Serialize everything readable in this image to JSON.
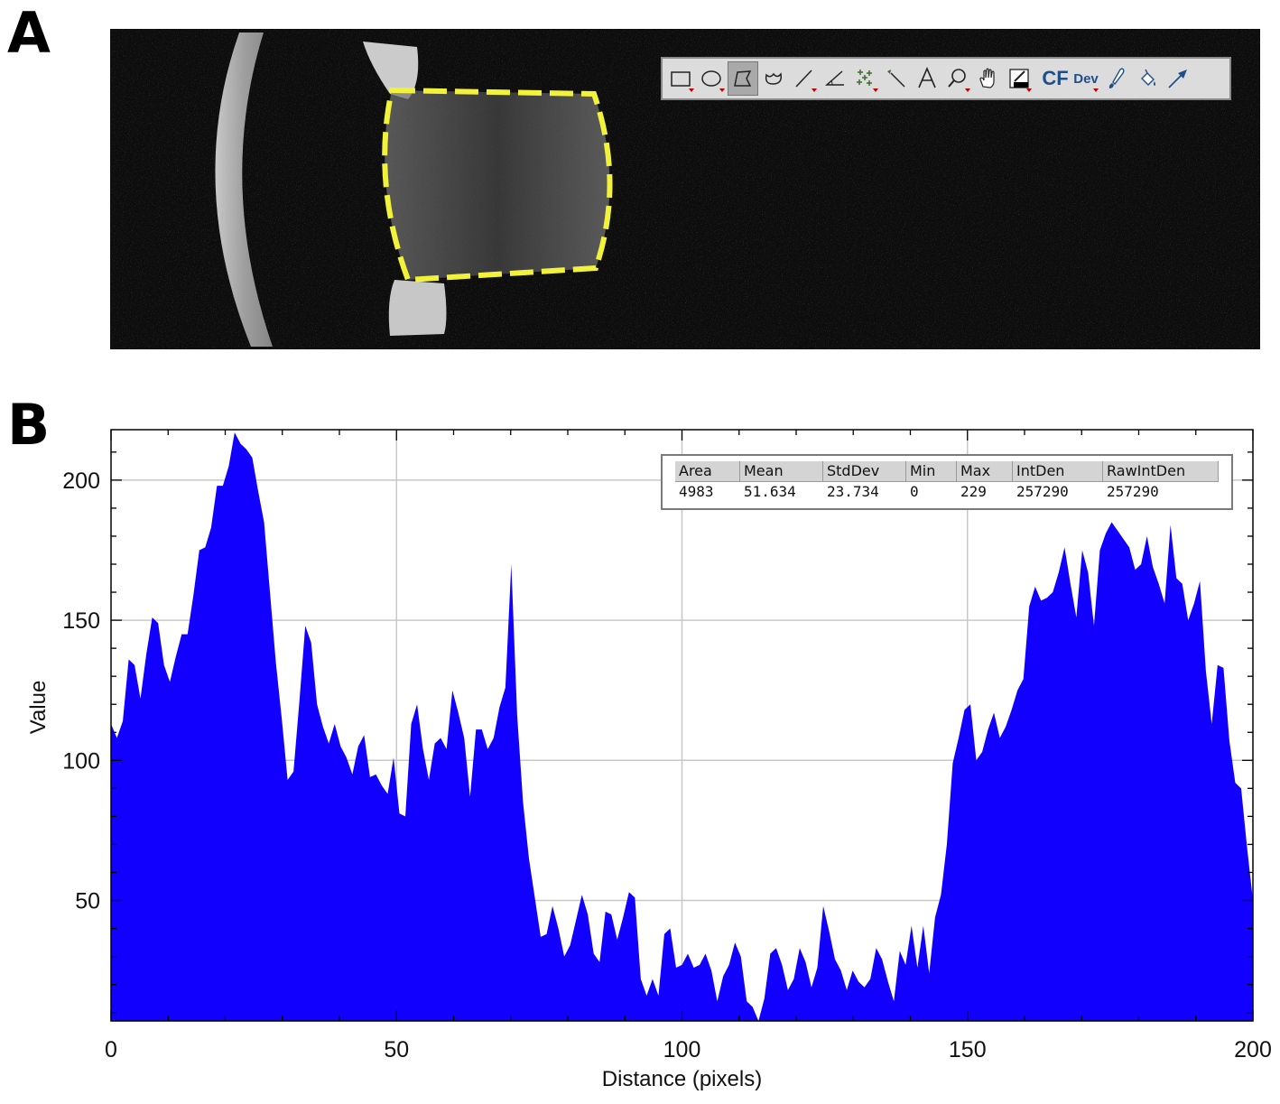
{
  "panels": {
    "a_label": "A",
    "b_label": "B"
  },
  "toolbar": {
    "tools": [
      {
        "name": "rectangle-tool-icon",
        "has_menu": true
      },
      {
        "name": "oval-tool-icon",
        "has_menu": true
      },
      {
        "name": "polygon-tool-icon",
        "has_menu": false,
        "selected": true
      },
      {
        "name": "freehand-tool-icon",
        "has_menu": false
      },
      {
        "name": "line-tool-icon",
        "has_menu": true
      },
      {
        "name": "angle-tool-icon",
        "has_menu": false
      },
      {
        "name": "multipoint-tool-icon",
        "has_menu": true
      },
      {
        "name": "wand-tool-icon",
        "has_menu": false
      },
      {
        "name": "text-tool-icon",
        "has_menu": false
      },
      {
        "name": "magnifier-tool-icon",
        "has_menu": true
      },
      {
        "name": "hand-tool-icon",
        "has_menu": false
      },
      {
        "name": "color-picker-tool-icon",
        "has_menu": true
      }
    ],
    "cf_label": "CF",
    "dev_label": "Dev",
    "extra_tools": [
      "brush-tool-icon",
      "flood-fill-tool-icon",
      "arrow-tool-icon"
    ]
  },
  "measurements": {
    "headers": [
      "Area",
      "Mean",
      "StdDev",
      "Min",
      "Max",
      "IntDen",
      "RawIntDen"
    ],
    "values": [
      "4983",
      "51.634",
      "23.734",
      "0",
      "229",
      "257290",
      "257290"
    ]
  },
  "colors": {
    "fill": "#1200ff",
    "roi": "#f2f23a",
    "grid": "#c8c8c8"
  },
  "chart_data": {
    "type": "area",
    "xlabel": "Distance (pixels)",
    "ylabel": "Value",
    "xlim": [
      0,
      200
    ],
    "ylim": [
      7,
      218
    ],
    "xticks": [
      0,
      50,
      100,
      150,
      200
    ],
    "yticks": [
      50,
      100,
      150,
      200
    ],
    "x_tick_labels": [
      "0",
      "50",
      "100",
      "150",
      "200"
    ],
    "y_tick_labels": [
      "50",
      "100",
      "150",
      "200"
    ],
    "grid": true,
    "series": [
      {
        "values": [
          113,
          108,
          114,
          136,
          134,
          122,
          138,
          151,
          149,
          134,
          128,
          137,
          145,
          145,
          159,
          175,
          176,
          183,
          198,
          198,
          205,
          217,
          213,
          211,
          208,
          196,
          185,
          160,
          135,
          115,
          93,
          96,
          121,
          148,
          142,
          120,
          112,
          106,
          113,
          105,
          101,
          95,
          105,
          109,
          94,
          95,
          91,
          88,
          101,
          81,
          80,
          113,
          120,
          104,
          93,
          106,
          108,
          104,
          125,
          117,
          108,
          87,
          111,
          111,
          104,
          108,
          119,
          126,
          170,
          116,
          85,
          65,
          51,
          37,
          38,
          48,
          40,
          30,
          34,
          43,
          52,
          45,
          31,
          28,
          46,
          45,
          36,
          44,
          53,
          51,
          22,
          16,
          22,
          16,
          38,
          40,
          26,
          27,
          31,
          26,
          27,
          31,
          25,
          14,
          23,
          27,
          35,
          30,
          14,
          12,
          7,
          15,
          31,
          33,
          27,
          18,
          22,
          33,
          28,
          19,
          26,
          48,
          39,
          29,
          25,
          18,
          25,
          21,
          19,
          22,
          33,
          29,
          21,
          14,
          32,
          27,
          41,
          26,
          41,
          24,
          44,
          52,
          70,
          99,
          108,
          118,
          120,
          100,
          103,
          111,
          117,
          108,
          112,
          118,
          125,
          129,
          155,
          162,
          157,
          158,
          160,
          167,
          176,
          163,
          151,
          175,
          167,
          148,
          175,
          181,
          185,
          182,
          179,
          176,
          168,
          170,
          180,
          169,
          163,
          156,
          184,
          165,
          163,
          150,
          156,
          164,
          132,
          113,
          134,
          133,
          107,
          92,
          90,
          69,
          50
        ]
      }
    ]
  }
}
